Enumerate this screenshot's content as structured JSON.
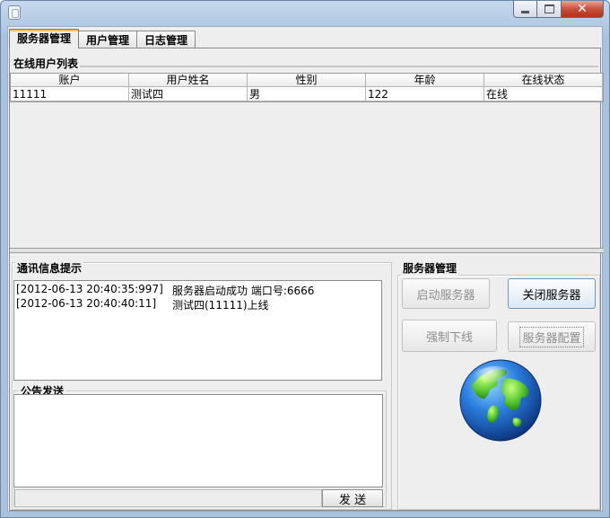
{
  "tabs": [
    {
      "label": "服务器管理"
    },
    {
      "label": "用户管理"
    },
    {
      "label": "日志管理"
    }
  ],
  "online_users": {
    "title": "在线用户列表",
    "columns": [
      "账户",
      "用户姓名",
      "性别",
      "年龄",
      "在线状态"
    ],
    "rows": [
      [
        "11111",
        "测试四",
        "男",
        "122",
        "在线"
      ]
    ]
  },
  "messages": {
    "title": "通讯信息提示",
    "lines": [
      {
        "time": "[2012-06-13 20:40:35:997]",
        "text": "服务器启动成功 端口号:6666"
      },
      {
        "time": "[2012-06-13 20:40:40:11]",
        "text": "测试四(11111)上线"
      }
    ]
  },
  "announcement": {
    "title": "公告发送",
    "value": "",
    "send_label": "发 送"
  },
  "server_panel": {
    "title": "服务器管理",
    "start_label": "启动服务器",
    "stop_label": "关闭服务器",
    "kick_label": "强制下线",
    "config_label": "服务器配置"
  },
  "icons": {
    "globe": "globe-icon",
    "app": "app-icon"
  },
  "colors": {
    "globe_ocean": "#1b5fc6",
    "globe_land": "#5fcf3a",
    "tab_highlight": "#f9c15c"
  }
}
